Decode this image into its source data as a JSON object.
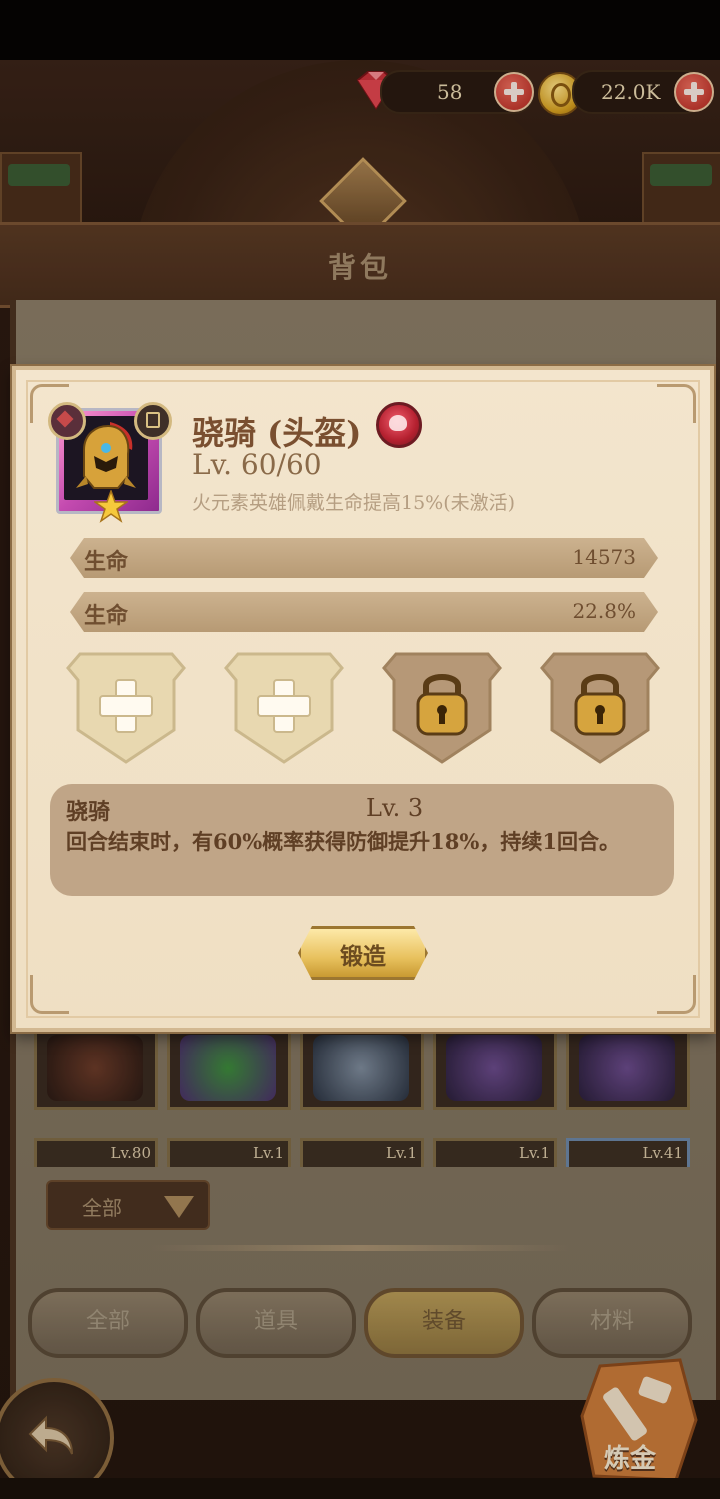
{
  "header": {
    "gems": "58",
    "gold": "22.0K",
    "title": "背包"
  },
  "item": {
    "name": "骁骑 (头盔)",
    "level": "Lv. 60/60",
    "set_desc": "火元素英雄佩戴生命提高15%(未激活)",
    "stats": [
      {
        "label": "生命",
        "value": "14573"
      },
      {
        "label": "生命",
        "value": "22.8%"
      }
    ],
    "skill": {
      "name": "骁骑",
      "level": "Lv. 3",
      "desc": "回合结束时，有60%概率获得防御提升18%，持续1回合。"
    },
    "forge_label": "锻造"
  },
  "inventory": {
    "levels": [
      "Lv.80",
      "Lv.1",
      "Lv.1",
      "Lv.1",
      "Lv.41"
    ],
    "filter": "全部"
  },
  "tabs": [
    "全部",
    "道具",
    "装备",
    "材料"
  ],
  "active_tab": "装备",
  "alchemy_label": "炼金",
  "colors": {
    "parchment": "#f0e0c6",
    "stat_bar": "#c3a882",
    "skill_box": "#c0a587",
    "accent_gold": "#e8c15e",
    "element_red": "#b4202f"
  }
}
